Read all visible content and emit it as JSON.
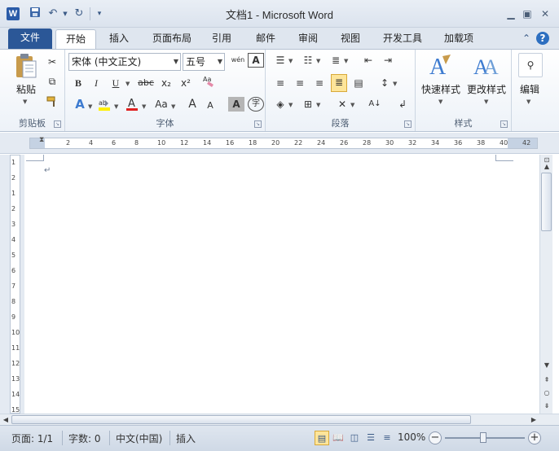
{
  "window": {
    "title": "文档1 - Microsoft Word"
  },
  "quick_access": {
    "app_letter": "W",
    "save_icon": "save-icon",
    "undo_icon": "undo-icon",
    "redo_icon": "redo-icon",
    "customize_icon": "customize-icon"
  },
  "tabs": [
    {
      "label": "文件"
    },
    {
      "label": "开始"
    },
    {
      "label": "插入"
    },
    {
      "label": "页面布局"
    },
    {
      "label": "引用"
    },
    {
      "label": "邮件"
    },
    {
      "label": "审阅"
    },
    {
      "label": "视图"
    },
    {
      "label": "开发工具"
    },
    {
      "label": "加载项"
    }
  ],
  "ribbon": {
    "clipboard": {
      "label": "剪贴板",
      "paste": "粘贴"
    },
    "font": {
      "label": "字体",
      "font_name": "宋体 (中文正文)",
      "font_size": "五号",
      "bold": "B",
      "italic": "I",
      "underline": "U",
      "strike": "abc",
      "subscript": "x₂",
      "superscript": "x²",
      "change_case": "Aa",
      "grow": "A",
      "shrink": "A",
      "char_border": "A",
      "phonetic": "wén",
      "enclose": "字",
      "char_shading": "A"
    },
    "paragraph": {
      "label": "段落"
    },
    "styles": {
      "label": "样式",
      "quick_styles": "快速样式",
      "change_styles": "更改样式"
    },
    "editing": {
      "label": "编辑"
    }
  },
  "ruler": {
    "h_ticks": [
      "2",
      "4",
      "6",
      "8",
      "10",
      "12",
      "14",
      "16",
      "18",
      "20",
      "22",
      "24",
      "26",
      "28",
      "30",
      "32",
      "34",
      "36",
      "38",
      "40",
      "42"
    ],
    "v_ticks": [
      "1",
      "2",
      "1",
      "2",
      "3",
      "4",
      "5",
      "6",
      "7",
      "8",
      "9",
      "10",
      "11",
      "12",
      "13",
      "14",
      "15"
    ]
  },
  "document": {
    "paragraph_mark": "↵"
  },
  "status": {
    "page": "页面: 1/1",
    "words": "字数: 0",
    "language": "中文(中国)",
    "mode": "插入",
    "zoom": "100%"
  },
  "colors": {
    "file_tab": "#2b5797",
    "accent": "#2d6fc0"
  }
}
